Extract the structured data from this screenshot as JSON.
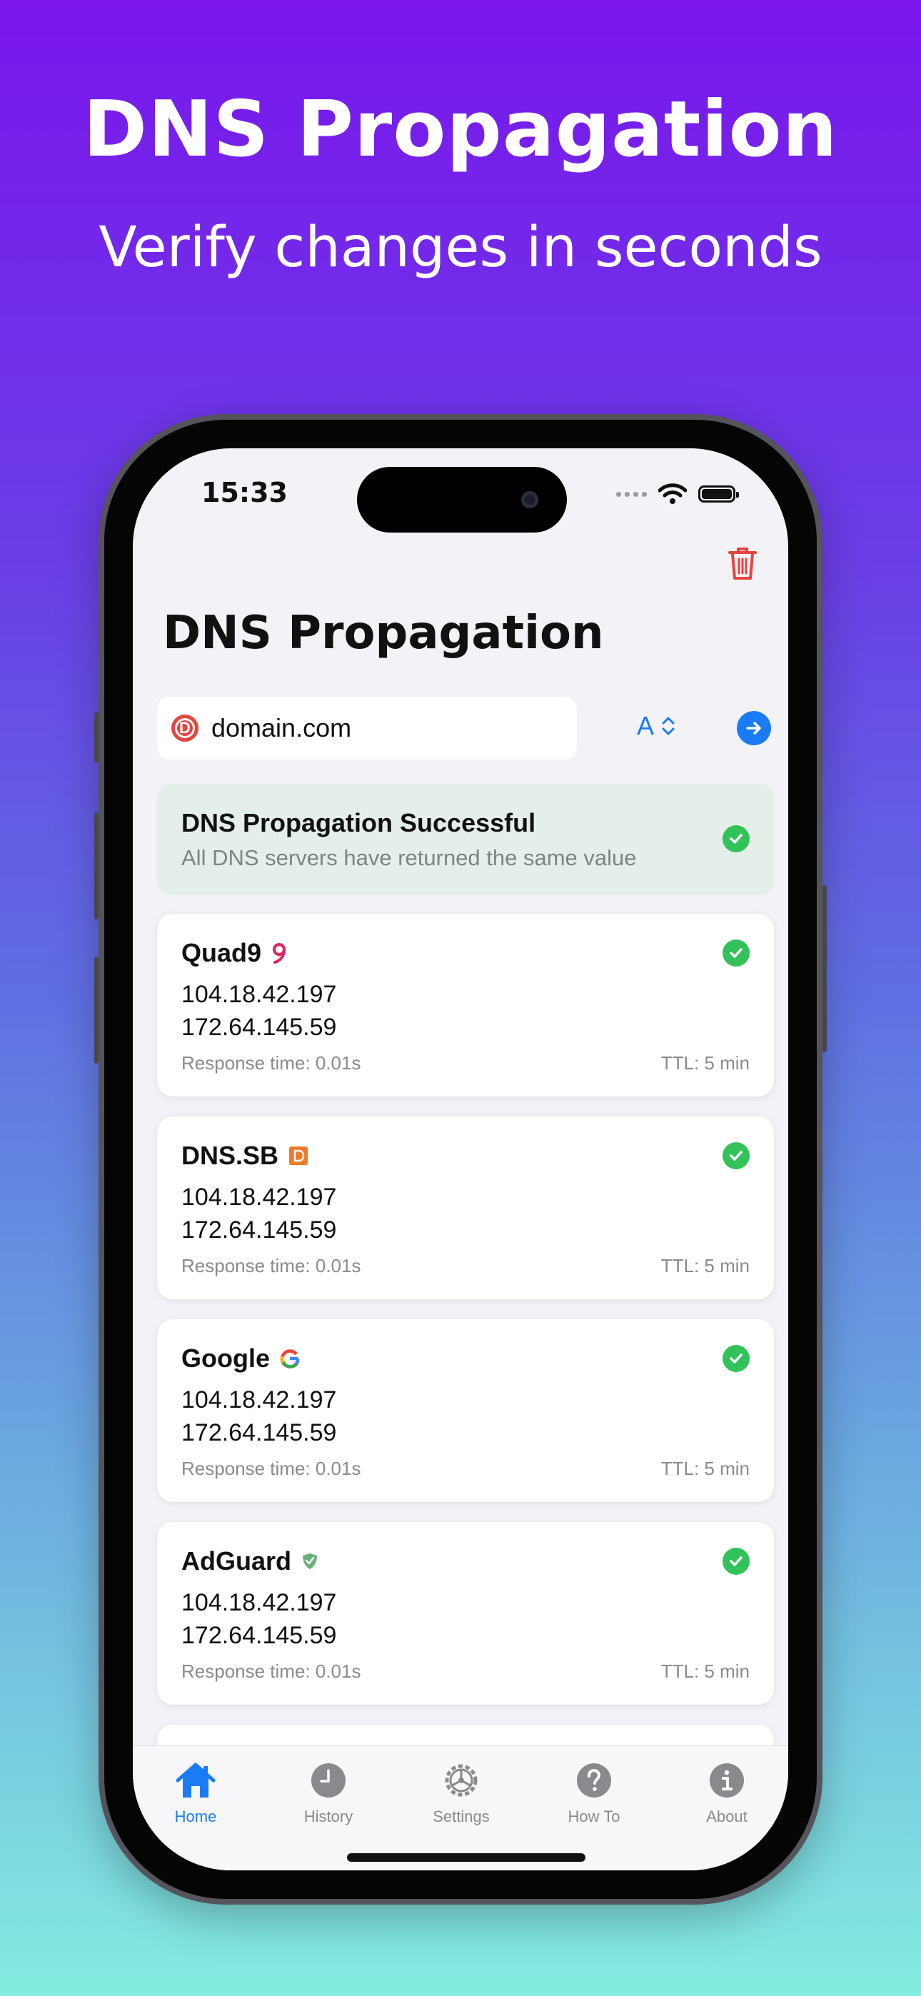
{
  "promo": {
    "headline": "DNS Propagation",
    "subline": "Verify changes in seconds"
  },
  "status_bar": {
    "time": "15:33"
  },
  "app": {
    "title": "DNS Propagation",
    "search_value": "domain.com",
    "record_type": "A",
    "banner": {
      "title": "DNS Propagation Successful",
      "subtitle": "All DNS servers have returned the same value"
    },
    "results": [
      {
        "name": "Quad9",
        "ip1": "104.18.42.197",
        "ip2": "172.64.145.59",
        "response": "Response time: 0.01s",
        "ttl": "TTL: 5 min"
      },
      {
        "name": "DNS.SB",
        "ip1": "104.18.42.197",
        "ip2": "172.64.145.59",
        "response": "Response time: 0.01s",
        "ttl": "TTL: 5 min"
      },
      {
        "name": "Google",
        "ip1": "104.18.42.197",
        "ip2": "172.64.145.59",
        "response": "Response time: 0.01s",
        "ttl": "TTL: 5 min"
      },
      {
        "name": "AdGuard",
        "ip1": "104.18.42.197",
        "ip2": "172.64.145.59",
        "response": "Response time: 0.01s",
        "ttl": "TTL: 5 min"
      }
    ]
  },
  "tabs": [
    {
      "label": "Home",
      "icon": "house-icon",
      "active": true
    },
    {
      "label": "History",
      "icon": "clock-icon",
      "active": false
    },
    {
      "label": "Settings",
      "icon": "gear-icon",
      "active": false
    },
    {
      "label": "How To",
      "icon": "question-icon",
      "active": false
    },
    {
      "label": "About",
      "icon": "info-icon",
      "active": false
    }
  ],
  "colors": {
    "accent": "#1a7cf5",
    "success": "#33c25a",
    "danger": "#e4453d"
  }
}
